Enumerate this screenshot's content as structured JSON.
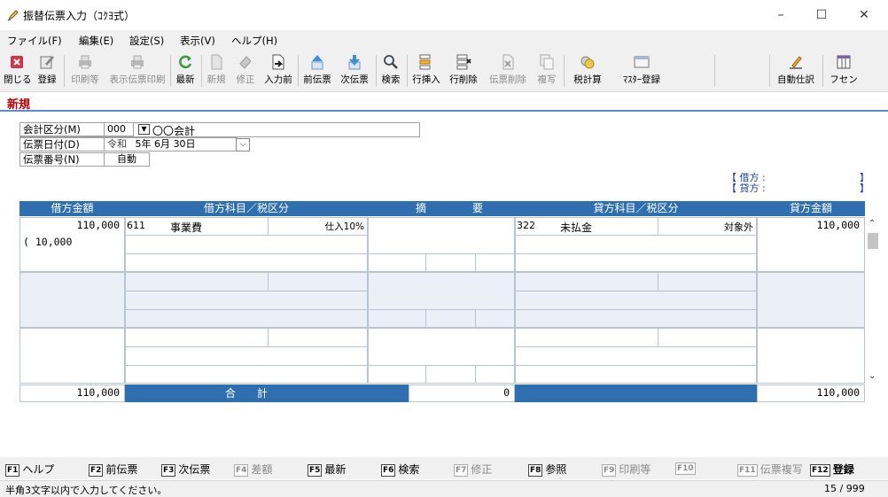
{
  "window": {
    "title": "振替伝票入力（ｺｸﾖ式）",
    "controls": [
      "–",
      "☐",
      "✕"
    ]
  },
  "menu": [
    "ファイル(F)",
    "編集(E)",
    "設定(S)",
    "表示(V)",
    "ヘルプ(H)"
  ],
  "toolbar": {
    "close": "閉じる",
    "register": "登録",
    "print": "印刷等",
    "display_print": "表示伝票印刷",
    "refresh": "最新",
    "new": "新規",
    "edit": "修正",
    "before_input": "入力前",
    "prev_slip": "前伝票",
    "next_slip": "次伝票",
    "search": "検索",
    "insert_row": "行挿入",
    "delete_row": "行削除",
    "delete_slip": "伝票削除",
    "copy": "複写",
    "tax_calc": "税計算",
    "master_register": "ﾏｽﾀｰ登録",
    "auto_journal": "自動仕訳",
    "sticky": "フセン"
  },
  "mode": "新規",
  "header": {
    "account_division_label": "会計区分(M)",
    "account_division_code": "000",
    "account_division_name": "〇〇会計",
    "slip_date_label": "伝票日付(D)",
    "era": "令和",
    "date": "5年  6月 30日",
    "slip_number_label": "伝票番号(N)",
    "slip_number": "自動"
  },
  "side_info": {
    "debit_label": "【 借方 :",
    "credit_label": "【 貸方 :",
    "debit_close": "】",
    "credit_close": "】"
  },
  "grid": {
    "headers": {
      "debit_amount": "借方金額",
      "debit_account": "借方科目／税区分",
      "summary_a": "摘",
      "summary_b": "要",
      "credit_account": "貸方科目／税区分",
      "credit_amount": "貸方金額"
    },
    "row1": {
      "debit_amount": "110,000",
      "debit_tax_amount": "(          10,000",
      "debit_code": "611",
      "debit_name": "事業費",
      "debit_tax": "仕入10%",
      "credit_code": "322",
      "credit_name": "未払金",
      "credit_tax": "対象外",
      "credit_amount": "110,000"
    },
    "total": {
      "debit": "110,000",
      "label": "合　　計",
      "diff": "0",
      "credit": "110,000"
    }
  },
  "fkeys": [
    {
      "key": "F1",
      "label": "ヘルプ"
    },
    {
      "key": "F2",
      "label": "前伝票"
    },
    {
      "key": "F3",
      "label": "次伝票"
    },
    {
      "key": "F4",
      "label": "差額"
    },
    {
      "key": "F5",
      "label": "最新"
    },
    {
      "key": "F6",
      "label": "検索"
    },
    {
      "key": "F7",
      "label": "修正"
    },
    {
      "key": "F8",
      "label": "参照"
    },
    {
      "key": "F9",
      "label": "印刷等"
    },
    {
      "key": "F10",
      "label": ""
    },
    {
      "key": "F11",
      "label": "伝票複写"
    },
    {
      "key": "F12",
      "label": "登録"
    }
  ],
  "status": {
    "message": "半角3文字以内で入力してください。",
    "counter": "15 / 999"
  },
  "colors": {
    "header_blue": "#2f6fb0",
    "mode_red": "#c00000",
    "row_shade": "#ebf0f7"
  }
}
